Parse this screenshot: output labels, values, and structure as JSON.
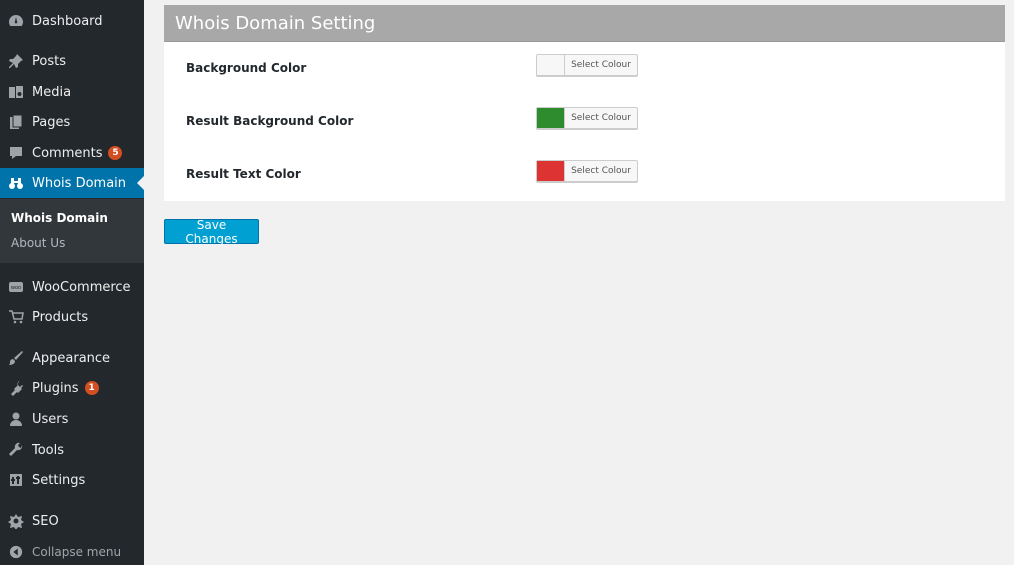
{
  "sidebar": {
    "items": [
      {
        "label": "Dashboard",
        "icon": "dashboard-icon"
      },
      {
        "label": "Posts",
        "icon": "pin-icon"
      },
      {
        "label": "Media",
        "icon": "media-icon"
      },
      {
        "label": "Pages",
        "icon": "pages-icon"
      },
      {
        "label": "Comments",
        "icon": "comment-icon",
        "badge": "5"
      },
      {
        "label": "Whois Domain",
        "icon": "binoculars-icon",
        "active": true
      },
      {
        "label": "WooCommerce",
        "icon": "woo-icon"
      },
      {
        "label": "Products",
        "icon": "cart-icon"
      },
      {
        "label": "Appearance",
        "icon": "brush-icon"
      },
      {
        "label": "Plugins",
        "icon": "plugin-icon",
        "badge": "1"
      },
      {
        "label": "Users",
        "icon": "user-icon"
      },
      {
        "label": "Tools",
        "icon": "wrench-icon"
      },
      {
        "label": "Settings",
        "icon": "settings-icon"
      },
      {
        "label": "SEO",
        "icon": "seo-icon"
      }
    ],
    "submenu": [
      {
        "label": "Whois Domain",
        "current": true
      },
      {
        "label": "About Us"
      }
    ],
    "collapse_label": "Collapse menu"
  },
  "panel": {
    "title": "Whois Domain Setting",
    "rows": [
      {
        "label": "Background Color",
        "button_label": "Select Colour",
        "color": "#f7f7f7"
      },
      {
        "label": "Result Background Color",
        "button_label": "Select Colour",
        "color": "#2e8b2e"
      },
      {
        "label": "Result Text Color",
        "button_label": "Select Colour",
        "color": "#dd3333"
      }
    ]
  },
  "save_label": "Save Changes",
  "colors": {
    "sidebar_bg": "#23282d",
    "active_bg": "#0073aa",
    "badge": "#d54e21",
    "button_primary": "#00a0d2"
  }
}
